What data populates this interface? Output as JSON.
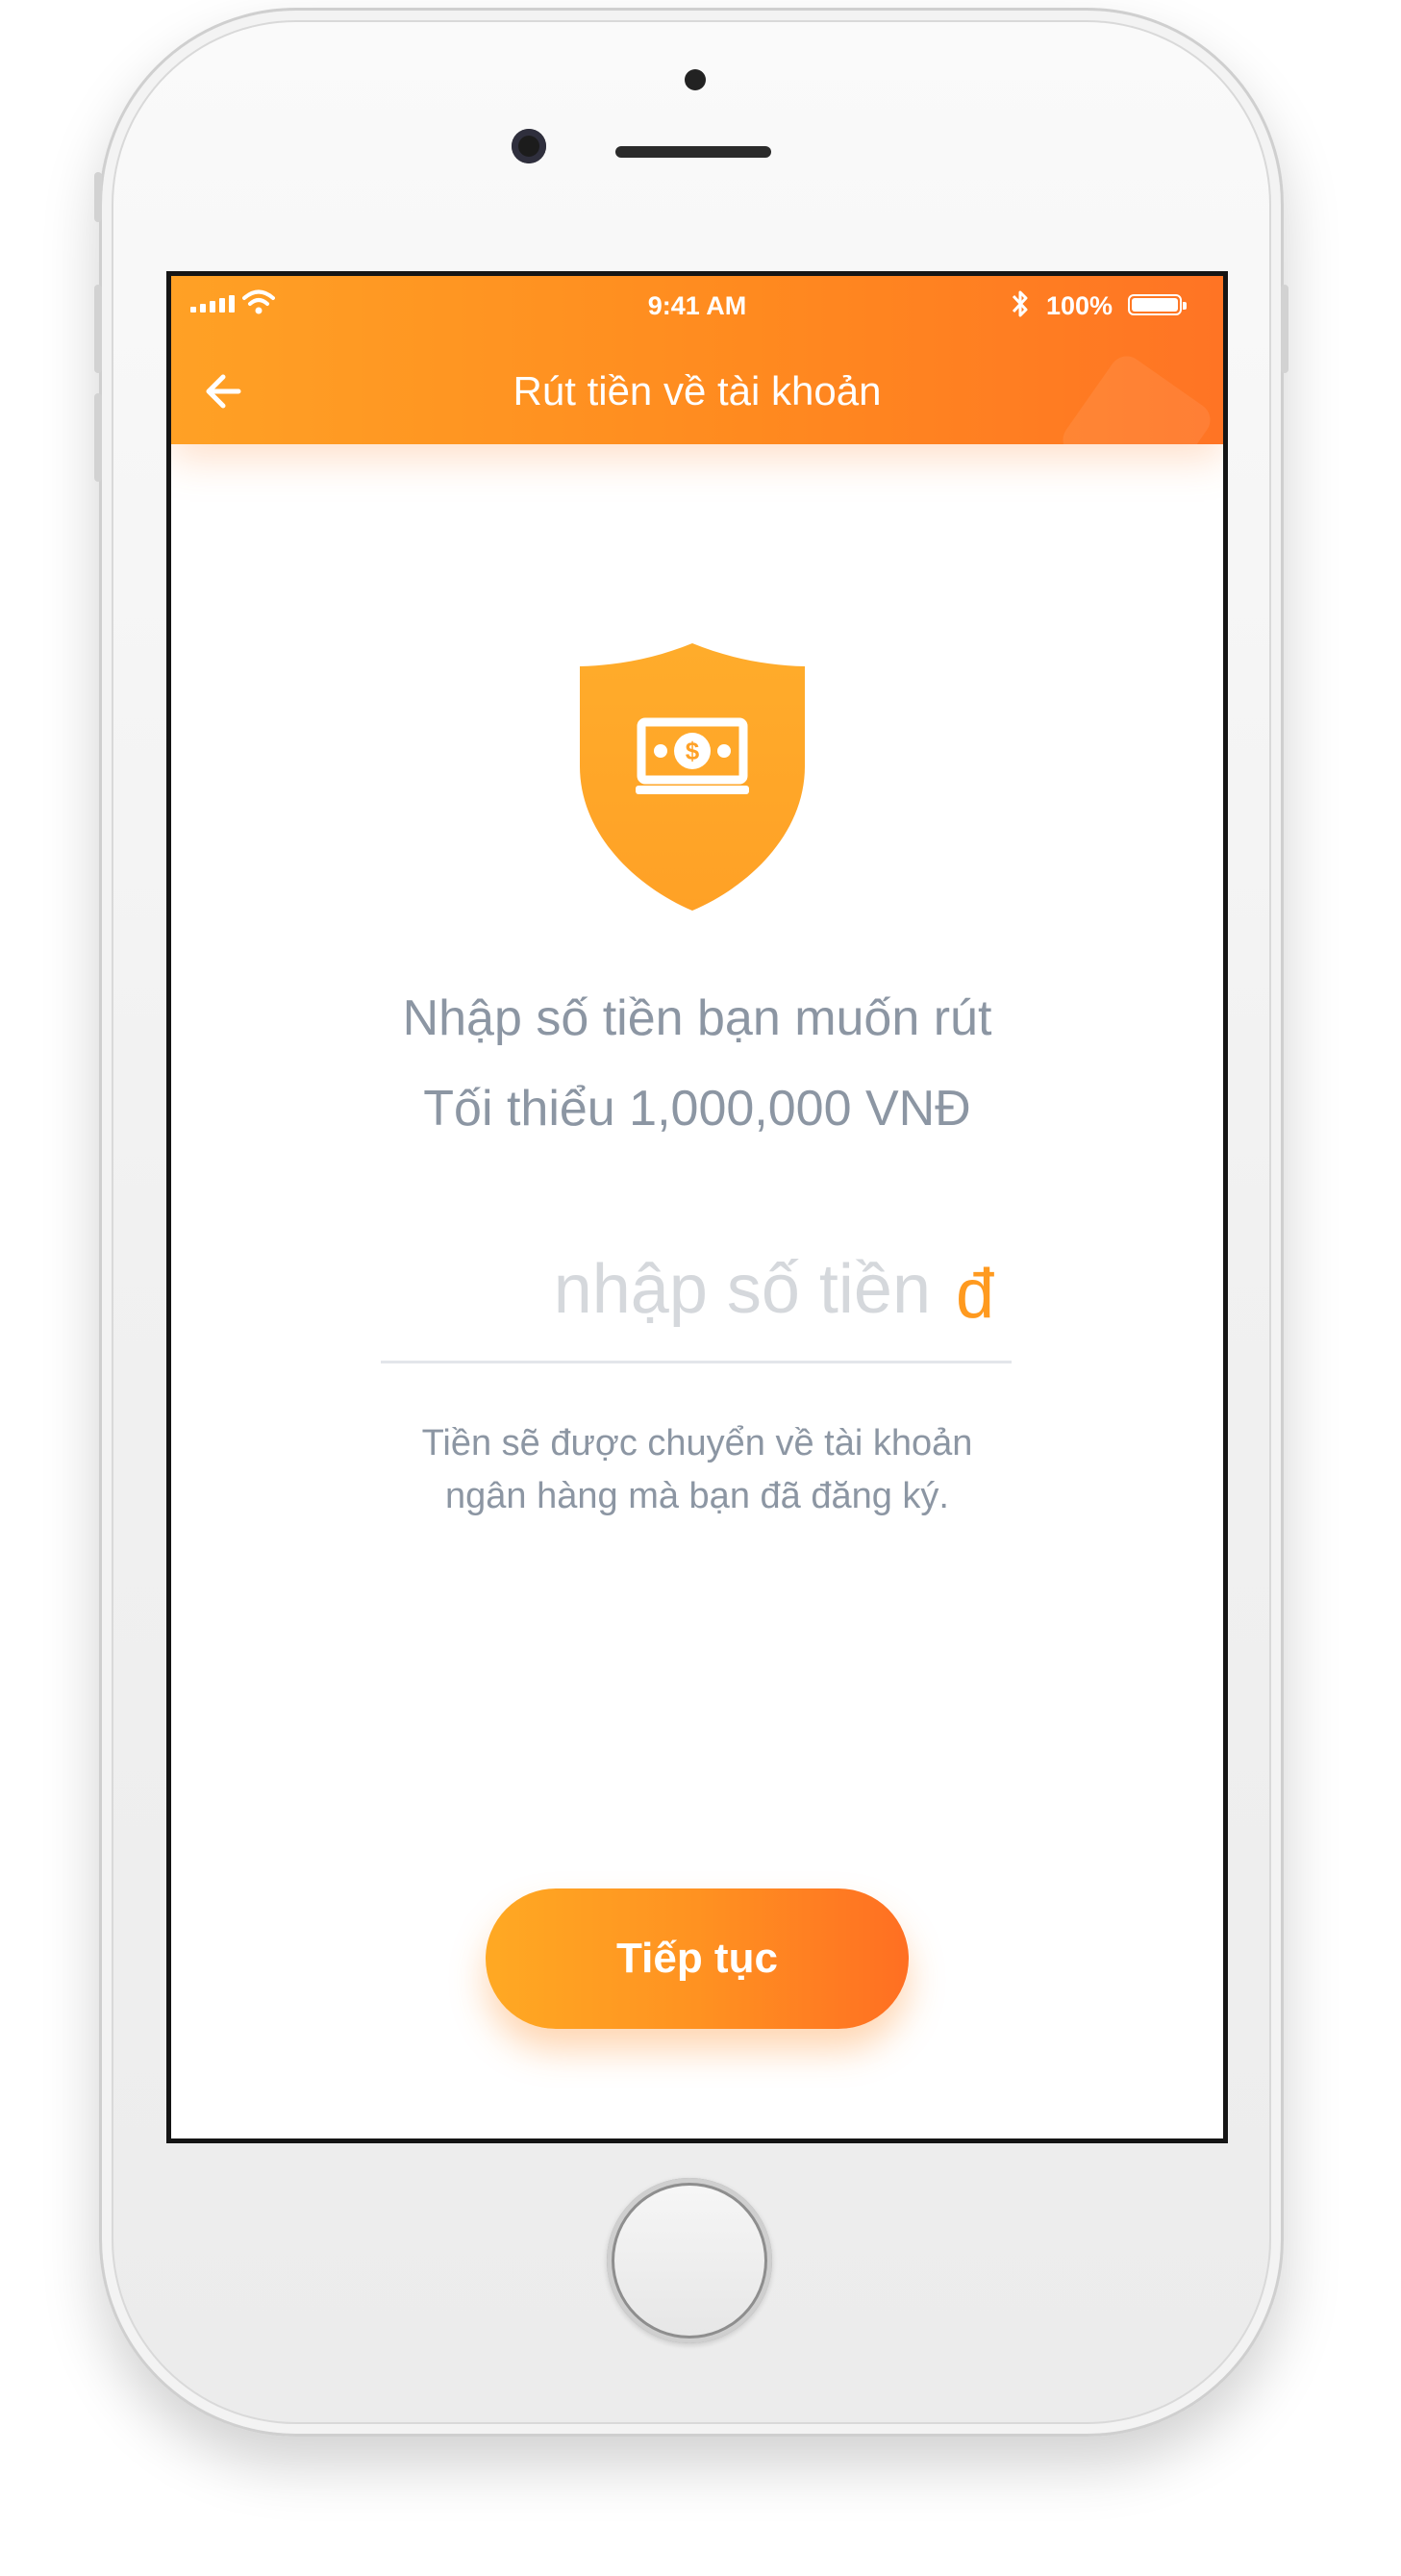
{
  "status_bar": {
    "time": "9:41 AM",
    "battery_percent": "100%",
    "battery_level": 1.0
  },
  "header": {
    "title": "Rút tiền về tài khoản",
    "back_icon": "arrow-left-icon"
  },
  "main": {
    "icon": "shield-money-icon",
    "prompt_line1": "Nhập số tiền bạn muốn rút",
    "prompt_line2": "Tối thiểu 1,000,000 VNĐ",
    "amount_placeholder": "nhập số tiền",
    "currency_symbol": "đ",
    "note_line1": "Tiền sẽ được chuyển về tài khoản",
    "note_line2": "ngân hàng mà bạn đã đăng ký.",
    "continue_label": "Tiếp tục"
  },
  "colors": {
    "accent": "#ff8a1f",
    "accent_start": "#ffa125",
    "accent_end": "#ff7424",
    "text_muted": "#8c96a3"
  }
}
